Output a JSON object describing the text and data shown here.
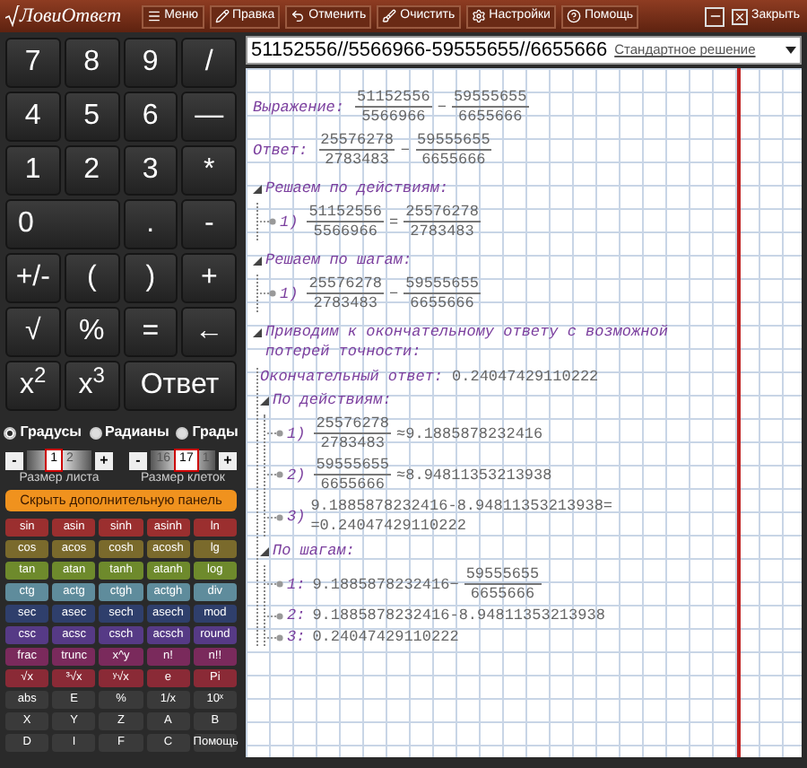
{
  "app_title": "ЛовиОтвет",
  "toolbar": [
    {
      "label": "Меню"
    },
    {
      "label": "Правка"
    },
    {
      "label": "Отменить"
    },
    {
      "label": "Очистить"
    },
    {
      "label": "Настройки"
    },
    {
      "label": "Помощь"
    }
  ],
  "close_button": "Закрыть",
  "expression": {
    "value": "51152556//5566966-59555655//6655666",
    "mode": "Стандартное решение"
  },
  "keypad": [
    {
      "label": "7",
      "wide": false
    },
    {
      "label": "8",
      "wide": false
    },
    {
      "label": "9",
      "wide": false
    },
    {
      "label": "/",
      "wide": false
    },
    {
      "label": "4",
      "wide": false
    },
    {
      "label": "5",
      "wide": false
    },
    {
      "label": "6",
      "wide": false
    },
    {
      "label": "—",
      "wide": false
    },
    {
      "label": "1",
      "wide": false
    },
    {
      "label": "2",
      "wide": false
    },
    {
      "label": "3",
      "wide": false
    },
    {
      "label": "*",
      "wide": false
    },
    {
      "label": "0",
      "wide": true
    },
    {
      "label": ".",
      "wide": false
    },
    {
      "label": "-",
      "wide": false
    },
    {
      "label": "+/-",
      "wide": false
    },
    {
      "label": "(",
      "wide": false
    },
    {
      "label": ")",
      "wide": false
    },
    {
      "label": "+",
      "wide": false
    },
    {
      "label": "√",
      "wide": false
    },
    {
      "label": "%",
      "wide": false
    },
    {
      "label": "=",
      "wide": false
    },
    {
      "label": "←",
      "wide": false
    },
    {
      "label": "x$^{2}$",
      "wide": false
    },
    {
      "label": "x$^{3}$",
      "wide": false
    },
    {
      "label": "Ответ",
      "wide": true
    }
  ],
  "angle_units": [
    {
      "label": "Градусы",
      "selected": true
    },
    {
      "label": "Радианы",
      "selected": false
    },
    {
      "label": "Грады",
      "selected": false
    }
  ],
  "steppers": [
    {
      "label": "Размер листа",
      "minus": "-",
      "value": "1",
      "next": "2",
      "plus": "+"
    },
    {
      "label": "Размер клеток",
      "minus": "-",
      "prev": "16",
      "value": "17",
      "next": "1",
      "plus": "+"
    }
  ],
  "hide_panel_button": "Скрыть дополнительную панель",
  "function_rows": [
    {
      "color": "#9b2f2f",
      "keys": [
        "sin",
        "asin",
        "sinh",
        "asinh",
        "ln"
      ]
    },
    {
      "color": "#7a6a2c",
      "keys": [
        "cos",
        "acos",
        "cosh",
        "acosh",
        "lg"
      ]
    },
    {
      "color": "#6e8a2c",
      "keys": [
        "tan",
        "atan",
        "tanh",
        "atanh",
        "log"
      ]
    },
    {
      "color": "#5f8c9c",
      "keys": [
        "ctg",
        "actg",
        "ctgh",
        "actgh",
        "div"
      ]
    },
    {
      "color": "#2f3f6c",
      "keys": [
        "sec",
        "asec",
        "sech",
        "asech",
        "mod"
      ]
    },
    {
      "color": "#563a86",
      "keys": [
        "csc",
        "acsc",
        "csch",
        "acsch",
        "round"
      ]
    },
    {
      "color": "#7a2a5c",
      "keys": [
        "frac",
        "trunc",
        "x^y",
        "n!",
        "n!!"
      ]
    },
    {
      "color": "#8a2a36",
      "keys": [
        "√x",
        "³√x",
        "ʸ√x",
        "e",
        "Pi"
      ]
    },
    {
      "color": "#3a3a3a",
      "keys": [
        "abs",
        "E",
        "%",
        "1/x",
        "10ˣ"
      ]
    },
    {
      "color": "#3a3a3a",
      "keys": [
        "X",
        "Y",
        "Z",
        "A",
        "B"
      ]
    },
    {
      "color": "#3a3a3a",
      "keys": [
        "D",
        "I",
        "F",
        "C",
        "Помощь"
      ]
    }
  ],
  "solution": [
    {
      "kind": "row",
      "label": "Выражение:",
      "parts": [
        {
          "kind": "frac",
          "num": "51152556",
          "den": "5566966"
        },
        {
          "kind": "op",
          "text": "−"
        },
        {
          "kind": "frac",
          "num": "59555655",
          "den": "6655666"
        }
      ]
    },
    {
      "kind": "row",
      "label": "Ответ:",
      "parts": [
        {
          "kind": "frac",
          "num": "25576278",
          "den": "2783483"
        },
        {
          "kind": "op",
          "text": "−"
        },
        {
          "kind": "frac",
          "num": "59555655",
          "den": "6655666"
        }
      ]
    },
    {
      "kind": "section",
      "title": "Решаем по действиям:",
      "children": [
        {
          "kind": "step",
          "label": "1)",
          "parts": [
            {
              "kind": "frac",
              "num": "51152556",
              "den": "5566966"
            },
            {
              "kind": "op",
              "text": "="
            },
            {
              "kind": "frac",
              "num": "25576278",
              "den": "2783483"
            }
          ]
        }
      ]
    },
    {
      "kind": "section",
      "title": "Решаем по шагам:",
      "children": [
        {
          "kind": "step",
          "label": "1)",
          "parts": [
            {
              "kind": "frac",
              "num": "25576278",
              "den": "2783483"
            },
            {
              "kind": "op",
              "text": "−"
            },
            {
              "kind": "frac",
              "num": "59555655",
              "den": "6655666"
            }
          ]
        }
      ]
    },
    {
      "kind": "section",
      "title": "Приводим к окончательному ответу с возможной потерей точности:",
      "children": [
        {
          "kind": "row",
          "label": "Окончательный ответ:",
          "parts": [
            {
              "kind": "op",
              "text": "0.24047429110222"
            }
          ]
        },
        {
          "kind": "section",
          "title": "По действиям:",
          "children": [
            {
              "kind": "step",
              "label": "1)",
              "parts": [
                {
                  "kind": "frac",
                  "num": "25576278",
                  "den": "2783483"
                },
                {
                  "kind": "op",
                  "text": "≈9.1885878232416"
                }
              ]
            },
            {
              "kind": "step",
              "label": "2)",
              "parts": [
                {
                  "kind": "frac",
                  "num": "59555655",
                  "den": "6655666"
                },
                {
                  "kind": "op",
                  "text": "≈8.94811353213938"
                }
              ]
            },
            {
              "kind": "step",
              "label": "3)",
              "parts": [
                {
                  "kind": "lines",
                  "lines": [
                    "9.1885878232416-8.94811353213938=",
                    "=0.24047429110222"
                  ]
                }
              ]
            }
          ]
        },
        {
          "kind": "section",
          "title": "По шагам:",
          "children": [
            {
              "kind": "step",
              "label": "1:",
              "parts": [
                {
                  "kind": "op",
                  "text": "9.1885878232416−"
                },
                {
                  "kind": "frac",
                  "num": "59555655",
                  "den": "6655666"
                }
              ]
            },
            {
              "kind": "step",
              "label": "2:",
              "parts": [
                {
                  "kind": "op",
                  "text": "9.1885878232416-8.94811353213938"
                }
              ]
            },
            {
              "kind": "step",
              "label": "3:",
              "parts": [
                {
                  "kind": "op",
                  "text": "0.24047429110222"
                }
              ]
            }
          ]
        }
      ]
    }
  ]
}
